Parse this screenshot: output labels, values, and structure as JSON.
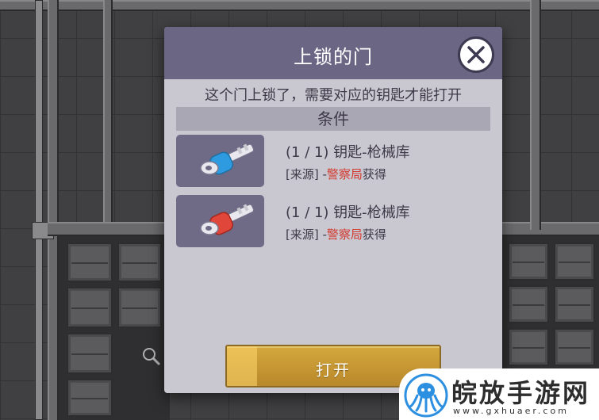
{
  "dialog": {
    "title": "上锁的门",
    "description": "这个门上锁了，需要对应的钥匙才能打开",
    "conditions_header": "条件",
    "open_button_label": "打开"
  },
  "requirements": [
    {
      "name": "(1 / 1) 钥匙-枪械库",
      "source_prefix": "[来源] -",
      "source_place": "警察局",
      "source_suffix": "获得",
      "key_color": "#2e9be0",
      "icon": "key-icon"
    },
    {
      "name": "(1 / 1) 钥匙-枪械库",
      "source_prefix": "[来源] -",
      "source_place": "警察局",
      "source_suffix": "获得",
      "key_color": "#e0463a",
      "icon": "key-icon"
    }
  ],
  "watermark": {
    "text": "皖放手游网",
    "url": "www.gxhuaer.com"
  },
  "colors": {
    "header": "#6c6685",
    "panel": "#c9c7cf",
    "button": "#c99a33",
    "highlight_text": "#d23b30"
  }
}
